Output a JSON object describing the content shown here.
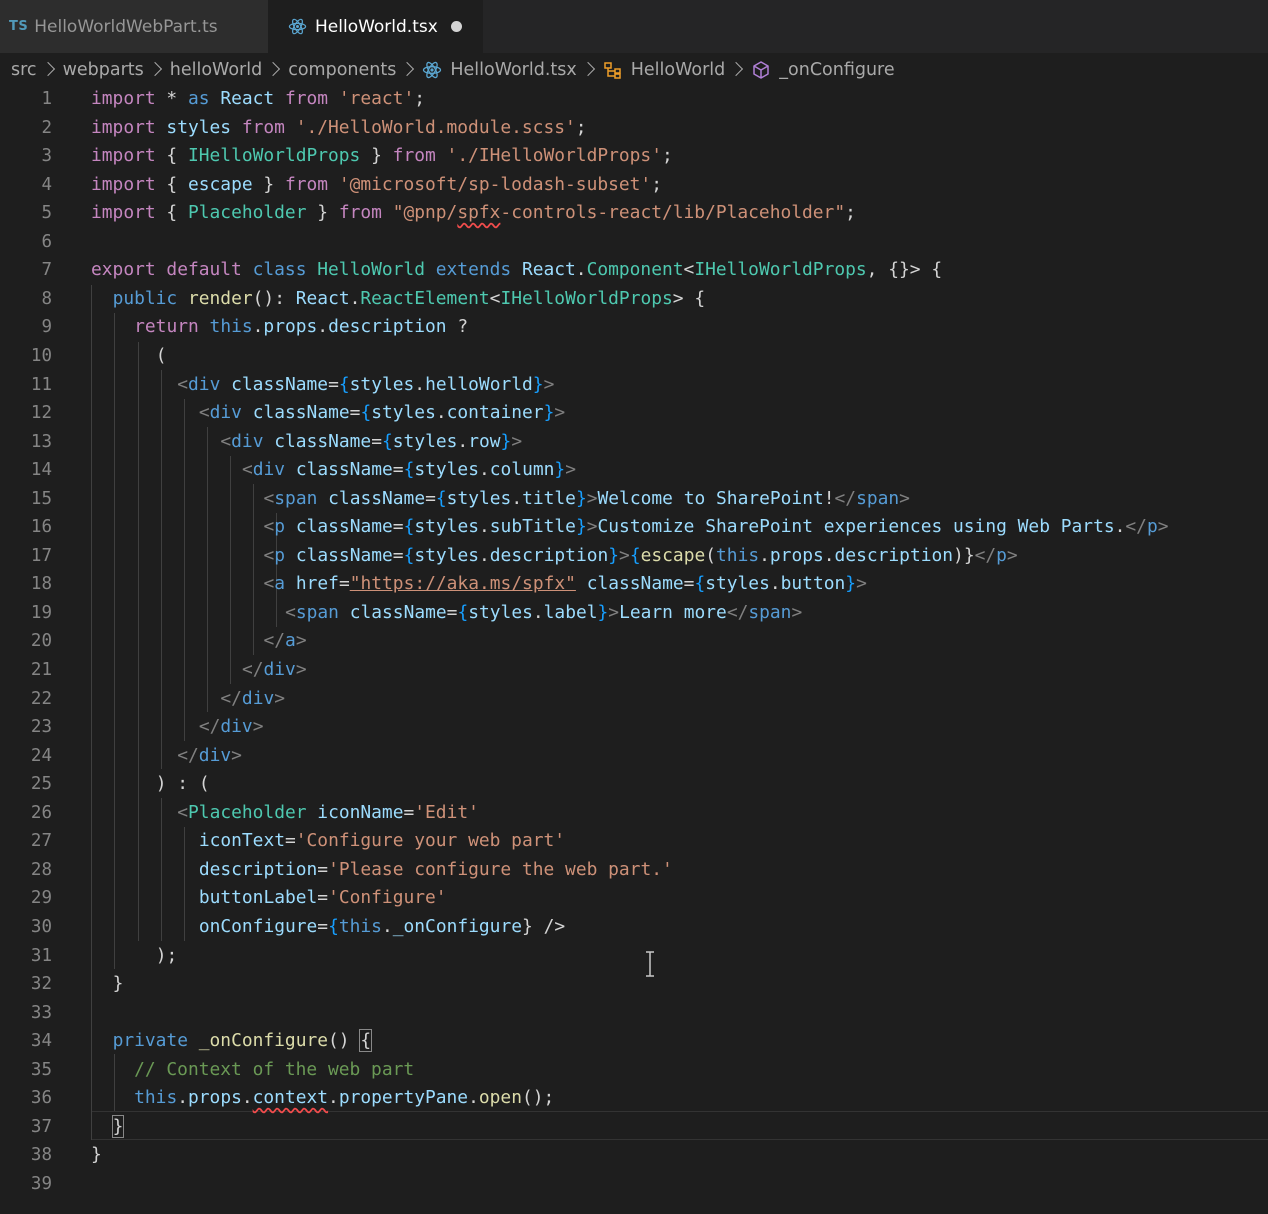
{
  "tabs": [
    {
      "badge": "TS",
      "label": "HelloWorldWebPart.ts",
      "active": false
    },
    {
      "label": "HelloWorld.tsx",
      "active": true,
      "dirty": true
    }
  ],
  "breadcrumb": {
    "segments": [
      "src",
      "webparts",
      "helloWorld",
      "components"
    ],
    "file": "HelloWorld.tsx",
    "class_name": "HelloWorld",
    "method": "_onConfigure"
  },
  "editor": {
    "language": "typescriptreact",
    "current_line": 37,
    "line_numbers": [
      "1",
      "2",
      "3",
      "4",
      "5",
      "6",
      "7",
      "8",
      "9",
      "10",
      "11",
      "12",
      "13",
      "14",
      "15",
      "16",
      "17",
      "18",
      "19",
      "20",
      "21",
      "22",
      "23",
      "24",
      "25",
      "26",
      "27",
      "28",
      "29",
      "30",
      "31",
      "32",
      "33",
      "34",
      "35",
      "36",
      "37",
      "38",
      "39"
    ],
    "lines": [
      "import * as React from 'react';",
      "import styles from './HelloWorld.module.scss';",
      "import { IHelloWorldProps } from './IHelloWorldProps';",
      "import { escape } from '@microsoft/sp-lodash-subset';",
      "import { Placeholder } from \"@pnp/spfx-controls-react/lib/Placeholder\";",
      "",
      "export default class HelloWorld extends React.Component<IHelloWorldProps, {}> {",
      "  public render(): React.ReactElement<IHelloWorldProps> {",
      "    return this.props.description ?",
      "      (",
      "        <div className={styles.helloWorld}>",
      "          <div className={styles.container}>",
      "            <div className={styles.row}>",
      "              <div className={styles.column}>",
      "                <span className={styles.title}>Welcome to SharePoint!</span>",
      "                <p className={styles.subTitle}>Customize SharePoint experiences using Web Parts.</p>",
      "                <p className={styles.description}>{escape(this.props.description)}</p>",
      "                <a href=\"https://aka.ms/spfx\" className={styles.button}>",
      "                  <span className={styles.label}>Learn more</span>",
      "                </a>",
      "              </div>",
      "            </div>",
      "          </div>",
      "        </div>",
      "      ) : (",
      "        <Placeholder iconName='Edit'",
      "          iconText='Configure your web part'",
      "          description='Please configure the web part.'",
      "          buttonLabel='Configure'",
      "          onConfigure={this._onConfigure} />",
      "      );",
      "  }",
      "",
      "  private _onConfigure() {",
      "    // Context of the web part",
      "    this.props.context.propertyPane.open();",
      "  }",
      "}",
      ""
    ]
  }
}
